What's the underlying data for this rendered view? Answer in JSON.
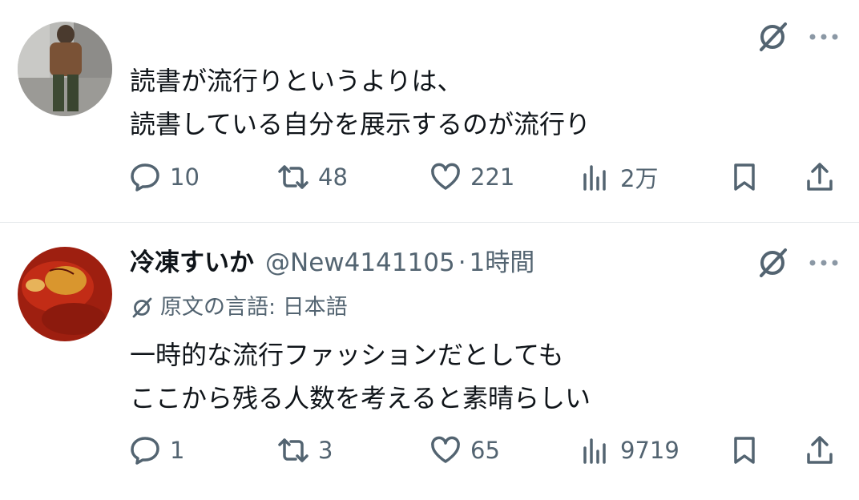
{
  "tweets": [
    {
      "display_name": "",
      "handle": "",
      "time": "",
      "lines": [
        "読書が流行りというよりは、",
        "読書している自分を展示するのが流行り"
      ],
      "stats": {
        "replies": "10",
        "retweets": "48",
        "likes": "221",
        "views": "2万"
      },
      "avatar": "person-standing-photo"
    },
    {
      "display_name": "冷凍すいか",
      "handle": "@New4141105",
      "separator": "·",
      "time": "1時間",
      "language_label": "原文の言語: 日本語",
      "lines": [
        "一時的な流行ファッションだとしても",
        "ここから残る人数を考えると素晴らしい"
      ],
      "stats": {
        "replies": "1",
        "retweets": "3",
        "likes": "65",
        "views": "9719"
      },
      "avatar": "red-sauce-photo"
    }
  ],
  "icons": {
    "reply": "speech-bubble-icon",
    "retweet": "retweet-arrows-icon",
    "like": "heart-icon",
    "views": "bar-chart-icon",
    "bookmark": "bookmark-icon",
    "share": "share-upload-icon",
    "grok": "slashed-circle-icon",
    "more": "three-dots-icon"
  },
  "colors": {
    "text": "#0f1419",
    "muted": "#536471",
    "divider": "#e6e9ec"
  }
}
